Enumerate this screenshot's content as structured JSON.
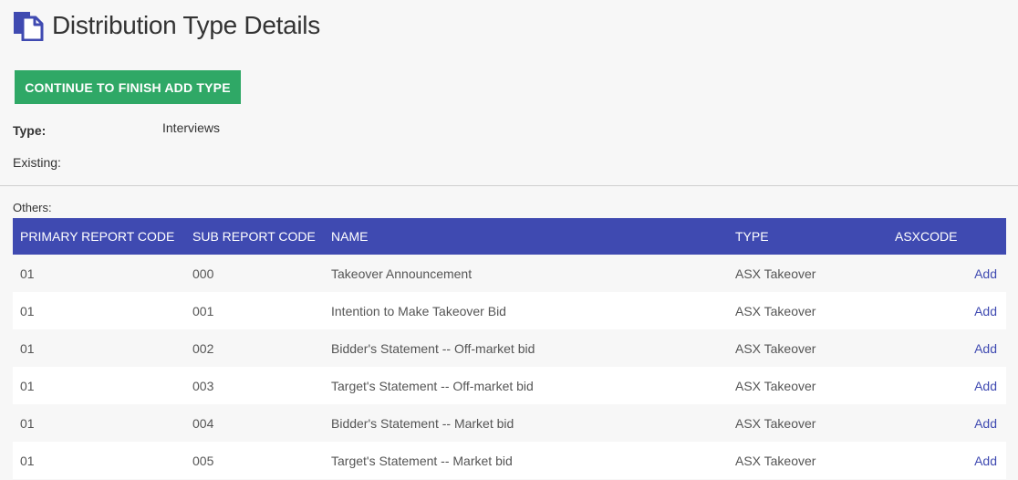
{
  "page": {
    "title": "Distribution Type Details",
    "title_icon": "document-copy-icon"
  },
  "actions": {
    "continue_label": "CONTINUE TO FINISH ADD TYPE"
  },
  "details": {
    "type_label": "Type:",
    "type_value": "Interviews",
    "existing_label": "Existing:",
    "others_label": "Others:"
  },
  "table": {
    "columns": [
      "PRIMARY REPORT CODE",
      "SUB REPORT CODE",
      "NAME",
      "TYPE",
      "ASXCODE"
    ],
    "rows": [
      {
        "primary": "01",
        "sub": "000",
        "name": "Takeover Announcement",
        "type": "ASX Takeover",
        "asxcode": "",
        "action": "Add"
      },
      {
        "primary": "01",
        "sub": "001",
        "name": "Intention to Make Takeover Bid",
        "type": "ASX Takeover",
        "asxcode": "",
        "action": "Add"
      },
      {
        "primary": "01",
        "sub": "002",
        "name": "Bidder's Statement -- Off-market bid",
        "type": "ASX Takeover",
        "asxcode": "",
        "action": "Add"
      },
      {
        "primary": "01",
        "sub": "003",
        "name": "Target's Statement -- Off-market bid",
        "type": "ASX Takeover",
        "asxcode": "",
        "action": "Add"
      },
      {
        "primary": "01",
        "sub": "004",
        "name": "Bidder's Statement -- Market bid",
        "type": "ASX Takeover",
        "asxcode": "",
        "action": "Add"
      },
      {
        "primary": "01",
        "sub": "005",
        "name": "Target's Statement -- Market bid",
        "type": "ASX Takeover",
        "asxcode": "",
        "action": "Add"
      }
    ]
  },
  "colors": {
    "accent": "#3f4ab1",
    "button": "#2fa866",
    "background": "#f7f7f7"
  }
}
